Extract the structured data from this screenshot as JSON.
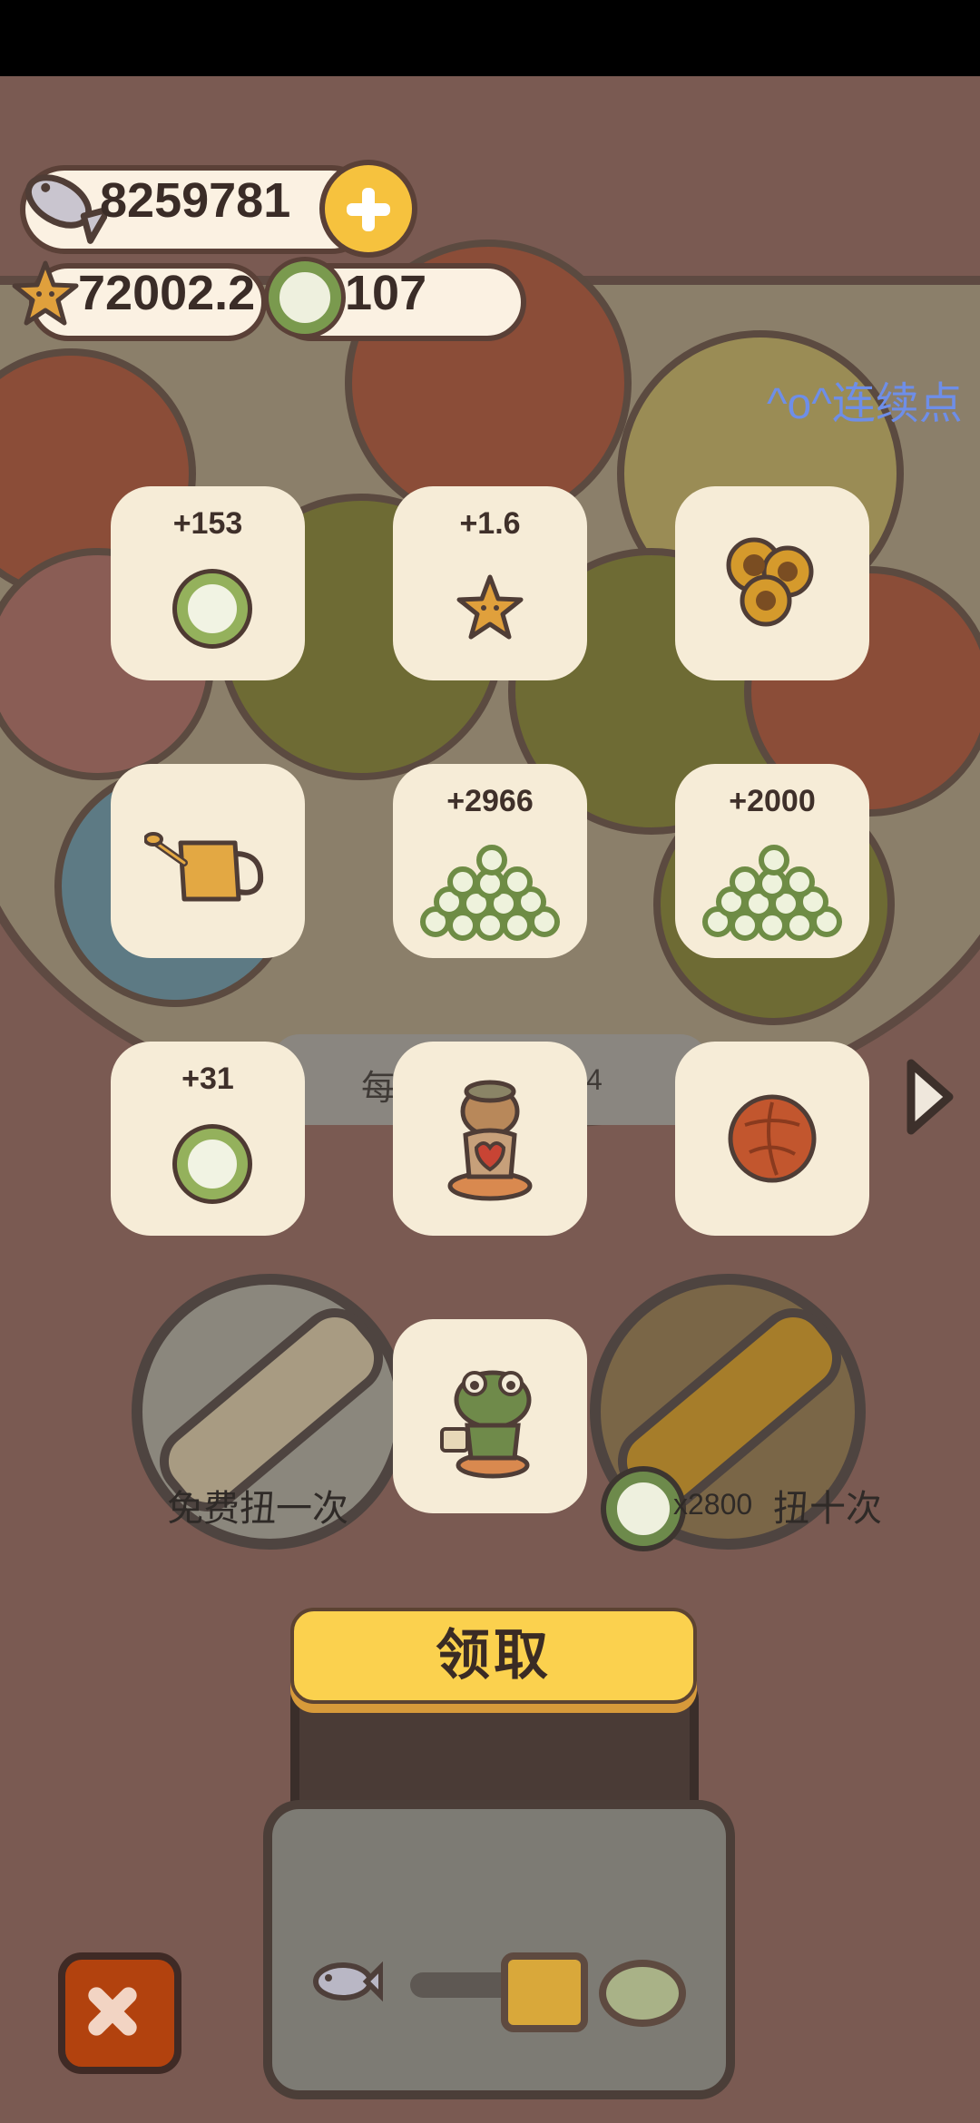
{
  "currencies": {
    "fish": "8259781",
    "stars": "72002.2",
    "coins": "107"
  },
  "marquee": "^o^连续点",
  "machine": {
    "free_spin_label": "免费扭一次",
    "ten_spin_cost": "x2800",
    "ten_spin_label": "扭十次",
    "panel_text_partial": "每",
    "panel_number_partial": "4"
  },
  "rewards": [
    {
      "label": "+153",
      "icon": "coin-icon"
    },
    {
      "label": "+1.6",
      "icon": "star-icon"
    },
    {
      "label": "",
      "icon": "sunflower-icon"
    },
    {
      "label": "",
      "icon": "watering-can-icon"
    },
    {
      "label": "+2966",
      "icon": "coin-pile-icon"
    },
    {
      "label": "+2000",
      "icon": "coin-pile-icon"
    },
    {
      "label": "+31",
      "icon": "coin-icon"
    },
    {
      "label": "",
      "icon": "dog-figurine-icon"
    },
    {
      "label": "",
      "icon": "yarn-ball-icon"
    },
    {
      "label": "",
      "icon": "frog-figurine-icon"
    }
  ],
  "claim_button": "领取",
  "colors": {
    "overlay_bg": "#f6ecd7",
    "claim_yellow": "#fbd14e",
    "close_red": "#b2420e"
  }
}
